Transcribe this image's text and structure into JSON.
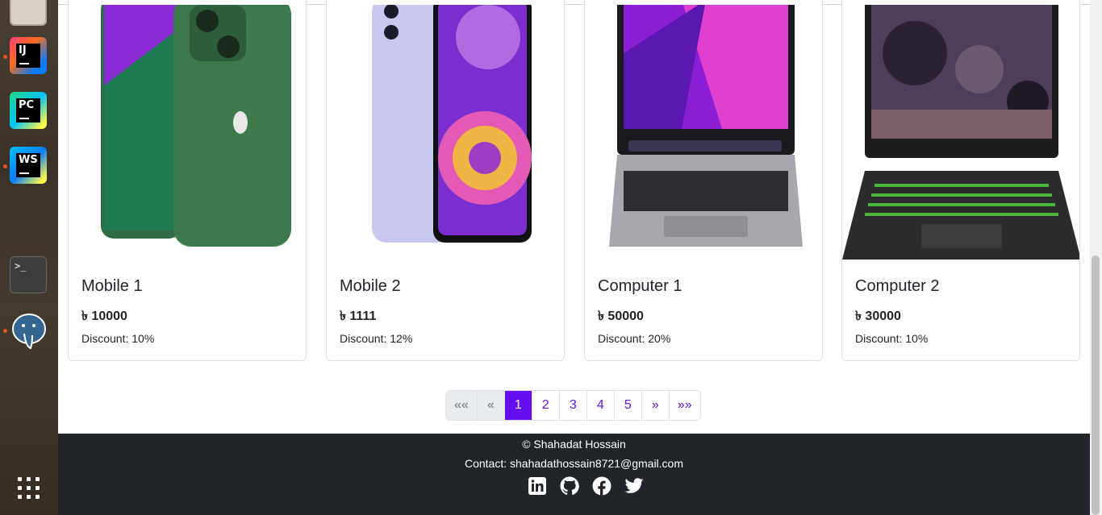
{
  "dock": {
    "apps": [
      {
        "name": "files",
        "label": ""
      },
      {
        "name": "intellij-idea",
        "label": "IJ"
      },
      {
        "name": "pycharm",
        "label": "PC"
      },
      {
        "name": "webstorm",
        "label": "WS"
      },
      {
        "name": "windows-app",
        "label": ""
      },
      {
        "name": "terminal",
        "label": ">_"
      },
      {
        "name": "postgresql",
        "label": ""
      },
      {
        "name": "show-apps",
        "label": ""
      }
    ]
  },
  "products": [
    {
      "title": "Mobile 1",
      "price": "৳ 10000",
      "discount": "Discount: 10%",
      "image": "green-iphone"
    },
    {
      "title": "Mobile 2",
      "price": "৳ 1111",
      "discount": "Discount: 12%",
      "image": "lavender-galaxy"
    },
    {
      "title": "Computer 1",
      "price": "৳ 50000",
      "discount": "Discount: 20%",
      "image": "silver-macbook"
    },
    {
      "title": "Computer 2",
      "price": "৳ 30000",
      "discount": "Discount: 10%",
      "image": "gaming-laptop"
    }
  ],
  "pagination": {
    "first": "««",
    "prev": "«",
    "pages": [
      "1",
      "2",
      "3",
      "4",
      "5"
    ],
    "active_page": "1",
    "next": "»",
    "last": "»»"
  },
  "footer": {
    "copyright": "© Shahadat Hossain",
    "contact": "Contact: shahadathossain8721@gmail.com",
    "social_icons": [
      "linkedin-icon",
      "github-icon",
      "facebook-icon",
      "twitter-icon"
    ]
  },
  "colors": {
    "accent": "#6610f2",
    "footer_bg": "#212529",
    "card_border": "#dee2e6"
  }
}
